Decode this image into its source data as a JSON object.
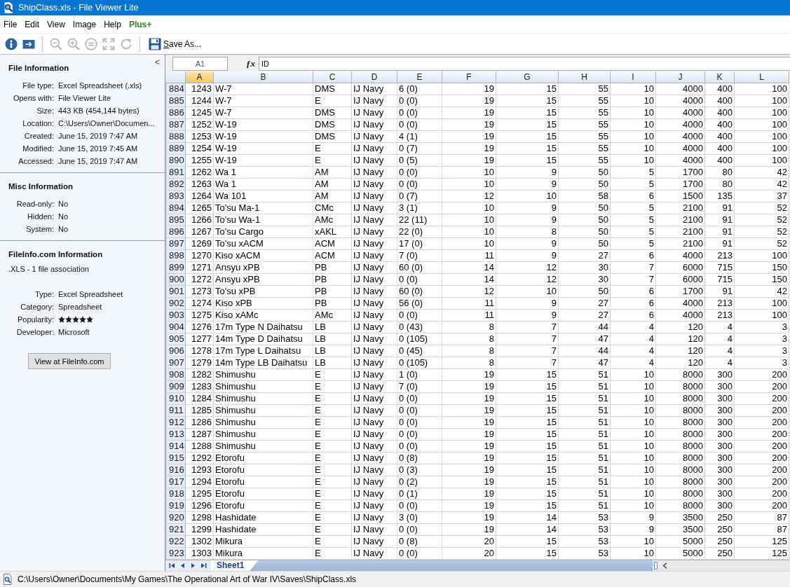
{
  "window": {
    "title": "ShipClass.xls - File Viewer Lite"
  },
  "menu": [
    {
      "label": "File",
      "kind": "menu"
    },
    {
      "label": "Edit",
      "kind": "menu"
    },
    {
      "label": "View",
      "kind": "menu"
    },
    {
      "label": "Image",
      "kind": "menu"
    },
    {
      "label": "Help",
      "kind": "menu"
    },
    {
      "label": "Plus+",
      "kind": "upgrade"
    }
  ],
  "toolbar": {
    "tools": [
      {
        "disabled": false
      },
      {
        "disabled": false
      },
      {
        "disabled": true
      },
      {
        "disabled": true
      },
      {
        "disabled": true
      },
      {
        "disabled": true
      },
      {
        "disabled": true
      }
    ],
    "save_as": {
      "label": "Save As..."
    }
  },
  "sidebar": {
    "collapse": "<",
    "sections": [
      {
        "title": "File Information",
        "fields": [
          {
            "label": "File type:",
            "value": "Excel Spreadsheet (.xls)"
          },
          {
            "label": "Opens with:",
            "value": "File Viewer Lite"
          },
          {
            "label": "Size:",
            "value": "443 KB (454,144 bytes)"
          },
          {
            "label": "Location:",
            "value": "C:\\Users\\Owner\\Documen..."
          },
          {
            "label": "Created:",
            "value": "June 15, 2019 7:47 AM"
          },
          {
            "label": "Modified:",
            "value": "June 15, 2019 7:45 AM"
          },
          {
            "label": "Accessed:",
            "value": "June 15, 2019 7:47 AM"
          }
        ]
      },
      {
        "title": "Misc Information",
        "fields": [
          {
            "label": "Read-only:",
            "value": "No"
          },
          {
            "label": "Hidden:",
            "value": "No"
          },
          {
            "label": "System:",
            "value": "No"
          }
        ]
      },
      {
        "title": "FileInfo.com Information",
        "subtitle": ".XLS - 1 file association",
        "fields": [
          {
            "label": "Type:",
            "value": "Excel Spreadsheet"
          },
          {
            "label": "Category:",
            "value": "Spreadsheet"
          },
          {
            "label": "Popularity:",
            "stars": 5
          },
          {
            "label": "Developer:",
            "value": "Microsoft"
          }
        ],
        "button": "View at FileInfo.com"
      }
    ]
  },
  "formula_bar": {
    "name_box": "A1",
    "function_label": "ƒx",
    "value": "ID"
  },
  "table": {
    "columns": [
      {
        "label": "A",
        "kind": "number",
        "selected": true
      },
      {
        "label": "B",
        "kind": "text",
        "selected": false
      },
      {
        "label": "C",
        "kind": "text",
        "selected": false
      },
      {
        "label": "D",
        "kind": "text",
        "selected": false
      },
      {
        "label": "E",
        "kind": "text",
        "selected": false
      },
      {
        "label": "F",
        "kind": "number",
        "selected": false
      },
      {
        "label": "G",
        "kind": "number",
        "selected": false
      },
      {
        "label": "H",
        "kind": "number",
        "selected": false
      },
      {
        "label": "I",
        "kind": "number",
        "selected": false
      },
      {
        "label": "J",
        "kind": "number",
        "selected": false
      },
      {
        "label": "K",
        "kind": "number",
        "selected": false
      },
      {
        "label": "L",
        "kind": "number",
        "selected": false
      }
    ],
    "rows": [
      {
        "number": "884",
        "cells": [
          "1243",
          "W-7",
          "DMS",
          "IJ Navy",
          "6 (0)",
          "19",
          "15",
          "55",
          "10",
          "4000",
          "400",
          "100"
        ]
      },
      {
        "number": "885",
        "cells": [
          "1244",
          "W-7",
          "E",
          "IJ Navy",
          "0 (0)",
          "19",
          "15",
          "55",
          "10",
          "4000",
          "400",
          "100"
        ]
      },
      {
        "number": "886",
        "cells": [
          "1245",
          "W-7",
          "DMS",
          "IJ Navy",
          "0 (0)",
          "19",
          "15",
          "55",
          "10",
          "4000",
          "400",
          "100"
        ]
      },
      {
        "number": "887",
        "cells": [
          "1252",
          "W-19",
          "DMS",
          "IJ Navy",
          "0 (0)",
          "19",
          "15",
          "55",
          "10",
          "4000",
          "400",
          "100"
        ]
      },
      {
        "number": "888",
        "cells": [
          "1253",
          "W-19",
          "DMS",
          "IJ Navy",
          "4 (1)",
          "19",
          "15",
          "55",
          "10",
          "4000",
          "400",
          "100"
        ]
      },
      {
        "number": "889",
        "cells": [
          "1254",
          "W-19",
          "E",
          "IJ Navy",
          "0 (7)",
          "19",
          "15",
          "55",
          "10",
          "4000",
          "400",
          "100"
        ]
      },
      {
        "number": "890",
        "cells": [
          "1255",
          "W-19",
          "E",
          "IJ Navy",
          "0 (5)",
          "19",
          "15",
          "55",
          "10",
          "4000",
          "400",
          "100"
        ]
      },
      {
        "number": "891",
        "cells": [
          "1262",
          "Wa 1",
          "AM",
          "IJ Navy",
          "0 (0)",
          "10",
          "9",
          "50",
          "5",
          "1700",
          "80",
          "42"
        ]
      },
      {
        "number": "892",
        "cells": [
          "1263",
          "Wa 1",
          "AM",
          "IJ Navy",
          "0 (0)",
          "10",
          "9",
          "50",
          "5",
          "1700",
          "80",
          "42"
        ]
      },
      {
        "number": "893",
        "cells": [
          "1264",
          "Wa 101",
          "AM",
          "IJ Navy",
          "0 (7)",
          "12",
          "10",
          "58",
          "6",
          "1500",
          "135",
          "37"
        ]
      },
      {
        "number": "894",
        "cells": [
          "1265",
          "To'su Ma-1",
          "CMc",
          "IJ Navy",
          "3 (1)",
          "10",
          "9",
          "50",
          "5",
          "2100",
          "91",
          "52"
        ]
      },
      {
        "number": "895",
        "cells": [
          "1266",
          "To'su Wa-1",
          "AMc",
          "IJ Navy",
          "22 (11)",
          "10",
          "9",
          "50",
          "5",
          "2100",
          "91",
          "52"
        ]
      },
      {
        "number": "896",
        "cells": [
          "1267",
          "To'su Cargo",
          "xAKL",
          "IJ Navy",
          "22 (0)",
          "10",
          "8",
          "50",
          "5",
          "2100",
          "91",
          "52"
        ]
      },
      {
        "number": "897",
        "cells": [
          "1269",
          "To'su xACM",
          "ACM",
          "IJ Navy",
          "17 (0)",
          "10",
          "9",
          "50",
          "5",
          "2100",
          "91",
          "52"
        ]
      },
      {
        "number": "898",
        "cells": [
          "1270",
          "Kiso xACM",
          "ACM",
          "IJ Navy",
          "7 (0)",
          "11",
          "9",
          "27",
          "6",
          "4000",
          "213",
          "100"
        ]
      },
      {
        "number": "899",
        "cells": [
          "1271",
          "Ansyu xPB",
          "PB",
          "IJ Navy",
          "60 (0)",
          "14",
          "12",
          "30",
          "7",
          "6000",
          "715",
          "150"
        ]
      },
      {
        "number": "900",
        "cells": [
          "1272",
          "Ansyu xPB",
          "PB",
          "IJ Navy",
          "0 (0)",
          "14",
          "12",
          "30",
          "7",
          "6000",
          "715",
          "150"
        ]
      },
      {
        "number": "901",
        "cells": [
          "1273",
          "To'su xPB",
          "PB",
          "IJ Navy",
          "60 (0)",
          "12",
          "10",
          "50",
          "6",
          "1700",
          "91",
          "42"
        ]
      },
      {
        "number": "902",
        "cells": [
          "1274",
          "Kiso xPB",
          "PB",
          "IJ Navy",
          "56 (0)",
          "11",
          "9",
          "27",
          "6",
          "4000",
          "213",
          "100"
        ]
      },
      {
        "number": "903",
        "cells": [
          "1275",
          "Kiso xAMc",
          "AMc",
          "IJ Navy",
          "0 (0)",
          "11",
          "9",
          "27",
          "6",
          "4000",
          "213",
          "100"
        ]
      },
      {
        "number": "904",
        "cells": [
          "1276",
          "17m Type N Daihatsu",
          "LB",
          "IJ Navy",
          "0 (43)",
          "8",
          "7",
          "44",
          "4",
          "120",
          "4",
          "3"
        ]
      },
      {
        "number": "905",
        "cells": [
          "1277",
          "14m Type D Daihatsu",
          "LB",
          "IJ Navy",
          "0 (105)",
          "8",
          "7",
          "47",
          "4",
          "120",
          "4",
          "3"
        ]
      },
      {
        "number": "906",
        "cells": [
          "1278",
          "17m Type L Daihatsu",
          "LB",
          "IJ Navy",
          "0 (45)",
          "8",
          "7",
          "44",
          "4",
          "120",
          "4",
          "3"
        ]
      },
      {
        "number": "907",
        "cells": [
          "1279",
          "14m Type LB Daihatsu",
          "LB",
          "IJ Navy",
          "0 (105)",
          "8",
          "7",
          "47",
          "4",
          "120",
          "4",
          "3"
        ]
      },
      {
        "number": "908",
        "cells": [
          "1282",
          "Shimushu",
          "E",
          "IJ Navy",
          "1 (0)",
          "19",
          "15",
          "51",
          "10",
          "8000",
          "300",
          "200"
        ]
      },
      {
        "number": "909",
        "cells": [
          "1283",
          "Shimushu",
          "E",
          "IJ Navy",
          "7 (0)",
          "19",
          "15",
          "51",
          "10",
          "8000",
          "300",
          "200"
        ]
      },
      {
        "number": "910",
        "cells": [
          "1284",
          "Shimushu",
          "E",
          "IJ Navy",
          "0 (0)",
          "19",
          "15",
          "51",
          "10",
          "8000",
          "300",
          "200"
        ]
      },
      {
        "number": "911",
        "cells": [
          "1285",
          "Shimushu",
          "E",
          "IJ Navy",
          "0 (0)",
          "19",
          "15",
          "51",
          "10",
          "8000",
          "300",
          "200"
        ]
      },
      {
        "number": "912",
        "cells": [
          "1286",
          "Shimushu",
          "E",
          "IJ Navy",
          "0 (0)",
          "19",
          "15",
          "51",
          "10",
          "8000",
          "300",
          "200"
        ]
      },
      {
        "number": "913",
        "cells": [
          "1287",
          "Shimushu",
          "E",
          "IJ Navy",
          "0 (0)",
          "19",
          "15",
          "51",
          "10",
          "8000",
          "300",
          "200"
        ]
      },
      {
        "number": "914",
        "cells": [
          "1288",
          "Shimushu",
          "E",
          "IJ Navy",
          "0 (0)",
          "19",
          "15",
          "51",
          "10",
          "8000",
          "300",
          "200"
        ]
      },
      {
        "number": "915",
        "cells": [
          "1292",
          "Etorofu",
          "E",
          "IJ Navy",
          "0 (8)",
          "19",
          "15",
          "51",
          "10",
          "8000",
          "300",
          "200"
        ]
      },
      {
        "number": "916",
        "cells": [
          "1293",
          "Etorofu",
          "E",
          "IJ Navy",
          "0 (3)",
          "19",
          "15",
          "51",
          "10",
          "8000",
          "300",
          "200"
        ]
      },
      {
        "number": "917",
        "cells": [
          "1294",
          "Etorofu",
          "E",
          "IJ Navy",
          "0 (2)",
          "19",
          "15",
          "51",
          "10",
          "8000",
          "300",
          "200"
        ]
      },
      {
        "number": "918",
        "cells": [
          "1295",
          "Etorofu",
          "E",
          "IJ Navy",
          "0 (1)",
          "19",
          "15",
          "51",
          "10",
          "8000",
          "300",
          "200"
        ]
      },
      {
        "number": "919",
        "cells": [
          "1296",
          "Etorofu",
          "E",
          "IJ Navy",
          "0 (0)",
          "19",
          "15",
          "51",
          "10",
          "8000",
          "300",
          "200"
        ]
      },
      {
        "number": "920",
        "cells": [
          "1298",
          "Hashidate",
          "E",
          "IJ Navy",
          "3 (0)",
          "19",
          "14",
          "53",
          "9",
          "3500",
          "250",
          "87"
        ]
      },
      {
        "number": "921",
        "cells": [
          "1299",
          "Hashidate",
          "E",
          "IJ Navy",
          "0 (0)",
          "19",
          "14",
          "53",
          "9",
          "3500",
          "250",
          "87"
        ]
      },
      {
        "number": "922",
        "cells": [
          "1302",
          "Mikura",
          "E",
          "IJ Navy",
          "0 (8)",
          "20",
          "15",
          "53",
          "10",
          "5000",
          "250",
          "125"
        ]
      },
      {
        "number": "923",
        "cells": [
          "1303",
          "Mikura",
          "E",
          "IJ Navy",
          "0 (0)",
          "20",
          "15",
          "53",
          "10",
          "5000",
          "250",
          "125"
        ]
      }
    ]
  },
  "sheet_tabs": [
    {
      "label": "Sheet1",
      "selected": true
    }
  ],
  "status_bar": {
    "path": "C:\\Users\\Owner\\Documents\\My Games\\The Operational Art of War IV\\Saves\\ShipClass.xls"
  }
}
